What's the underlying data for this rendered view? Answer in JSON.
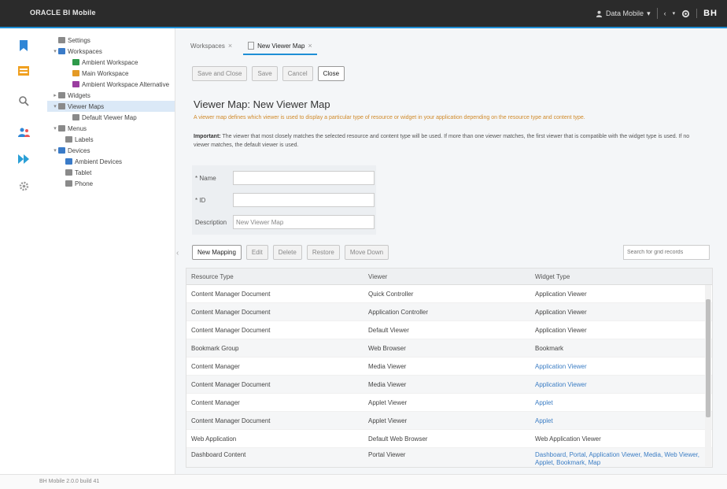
{
  "topbar": {
    "app_title": "ORACLE BI Mobile",
    "user": "Data Mobile",
    "logo_text": "BH"
  },
  "rail_icons": [
    "bookmark-icon",
    "dashboard-icon",
    "search-icon",
    "users-icon",
    "forward-icon",
    "settings-icon"
  ],
  "tree": {
    "items": [
      {
        "label": "Settings",
        "indent": 0,
        "twisty": "",
        "icon_color": "#8a8a8a"
      },
      {
        "label": "Workspaces",
        "indent": 0,
        "twisty": "▾",
        "icon_color": "#3a7bc8"
      },
      {
        "label": "Ambient Workspace",
        "indent": 2,
        "twisty": "",
        "icon_color": "#2e9a4a"
      },
      {
        "label": "Main Workspace",
        "indent": 2,
        "twisty": "",
        "icon_color": "#e49a25"
      },
      {
        "label": "Ambient Workspace Alternative",
        "indent": 2,
        "twisty": "",
        "icon_color": "#9b3ea0"
      },
      {
        "label": "Widgets",
        "indent": 0,
        "twisty": "▸",
        "icon_color": "#8a8a8a"
      },
      {
        "label": "Viewer Maps",
        "indent": 0,
        "twisty": "▾",
        "icon_color": "#8a8a8a",
        "selected": true
      },
      {
        "label": "Default Viewer Map",
        "indent": 2,
        "twisty": "",
        "icon_color": "#8a8a8a"
      },
      {
        "label": "Menus",
        "indent": 0,
        "twisty": "▾",
        "icon_color": "#8a8a8a"
      },
      {
        "label": "Labels",
        "indent": 1,
        "twisty": "",
        "icon_color": "#8a8a8a"
      },
      {
        "label": "Devices",
        "indent": 0,
        "twisty": "▾",
        "icon_color": "#3a7bc8"
      },
      {
        "label": "Ambient Devices",
        "indent": 1,
        "twisty": "",
        "icon_color": "#3a7bc8"
      },
      {
        "label": "Tablet",
        "indent": 1,
        "twisty": "",
        "icon_color": "#8a8a8a"
      },
      {
        "label": "Phone",
        "indent": 1,
        "twisty": "",
        "icon_color": "#8a8a8a"
      }
    ]
  },
  "tabs": [
    {
      "label": "Workspaces",
      "active": false
    },
    {
      "label": "New Viewer Map",
      "active": true
    }
  ],
  "toolbar": {
    "save_close": "Save and Close",
    "save": "Save",
    "cancel": "Cancel",
    "close": "Close"
  },
  "page": {
    "title": "Viewer Map: New Viewer Map",
    "description": "A viewer map defines which viewer is used to display a particular type of resource or widget in your application depending on the resource type and content type.",
    "important_label": "Important:",
    "important_text": "The viewer that most closely matches the selected resource and content type will be used. If more than one viewer matches, the first viewer that is compatible with the widget type is used. If no viewer matches, the default viewer is used."
  },
  "form": {
    "name_label": "* Name",
    "id_label": "* ID",
    "desc_label": "Description",
    "desc_value": "New Viewer Map"
  },
  "grid_toolbar": {
    "new": "New Mapping",
    "edit": "Edit",
    "delete": "Delete",
    "restore": "Restore",
    "move_down": "Move Down"
  },
  "search": {
    "placeholder": "Search for grid records"
  },
  "grid": {
    "headers": [
      "Resource Type",
      "Viewer",
      "Widget Type"
    ],
    "rows": [
      {
        "resource": "Content Manager Document",
        "viewer": "Quick Controller",
        "widget": "Application Viewer",
        "widget_link": false
      },
      {
        "resource": "Content Manager Document",
        "viewer": "Application Controller",
        "widget": "Application Viewer",
        "widget_link": false
      },
      {
        "resource": "Content Manager Document",
        "viewer": "Default Viewer",
        "widget": "Application Viewer",
        "widget_link": false
      },
      {
        "resource": "Bookmark Group",
        "viewer": "Web Browser",
        "widget": "Bookmark",
        "widget_link": false
      },
      {
        "resource": "Content Manager",
        "viewer": "Media Viewer",
        "widget": "Application Viewer",
        "widget_link": true
      },
      {
        "resource": "Content Manager Document",
        "viewer": "Media Viewer",
        "widget": "Application Viewer",
        "widget_link": true
      },
      {
        "resource": "Content Manager",
        "viewer": "Applet Viewer",
        "widget": "Applet",
        "widget_link": true
      },
      {
        "resource": "Content Manager Document",
        "viewer": "Applet Viewer",
        "widget": "Applet",
        "widget_link": true
      },
      {
        "resource": "Web Application",
        "viewer": "Default Web Browser",
        "widget": "Web Application Viewer",
        "widget_link": false
      },
      {
        "resource": "Dashboard Content",
        "viewer": "Portal Viewer",
        "widget": "Dashboard, Portal, Application Viewer, Media, Web Viewer, Applet, Bookmark, Map",
        "widget_link": true
      }
    ]
  },
  "footer": {
    "text": "BH Mobile 2.0.0 build 41"
  }
}
